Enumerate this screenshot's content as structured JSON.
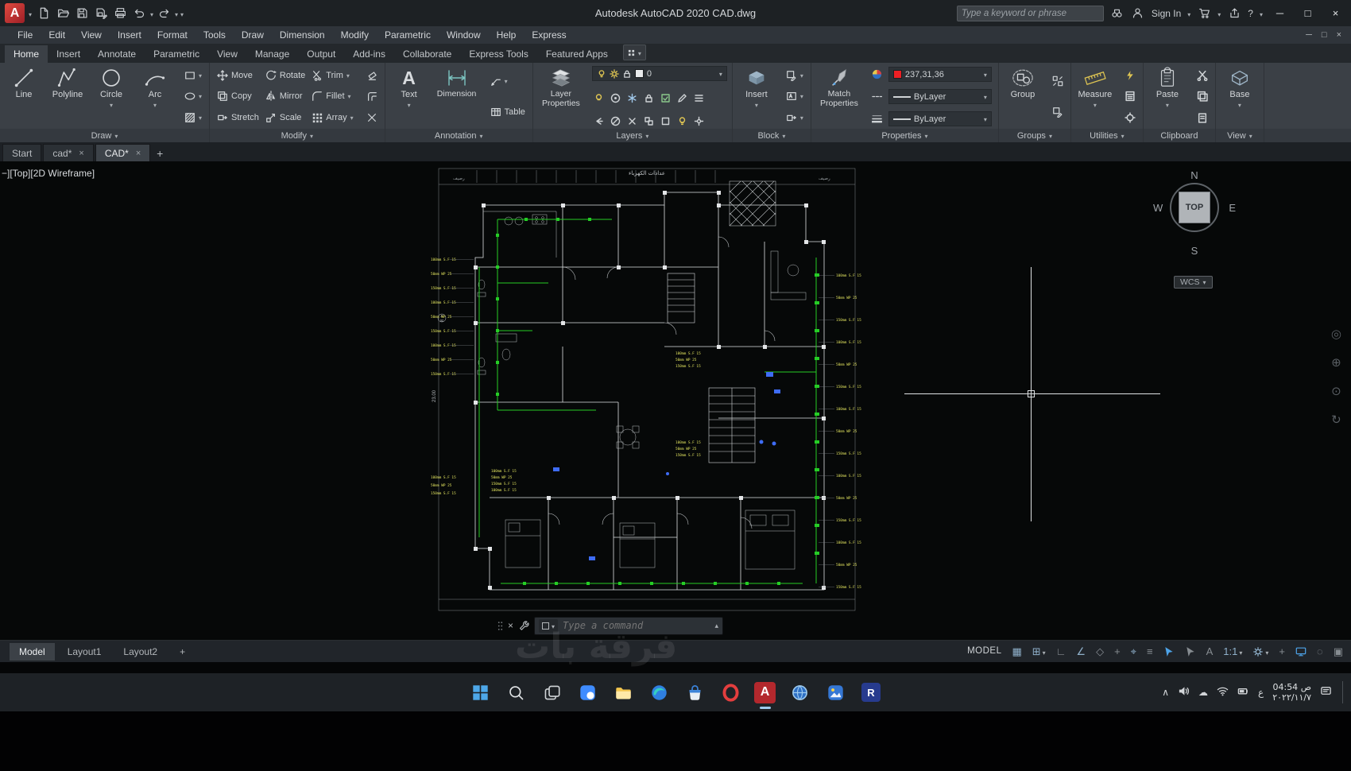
{
  "titlebar": {
    "title": "Autodesk AutoCAD 2020   CAD.dwg",
    "search_placeholder": "Type a keyword or phrase",
    "sign_in": "Sign In"
  },
  "menubar": {
    "items": [
      "File",
      "Edit",
      "View",
      "Insert",
      "Format",
      "Tools",
      "Draw",
      "Dimension",
      "Modify",
      "Parametric",
      "Window",
      "Help",
      "Express"
    ]
  },
  "ribbon": {
    "tabs": [
      "Home",
      "Insert",
      "Annotate",
      "Parametric",
      "View",
      "Manage",
      "Output",
      "Add-ins",
      "Collaborate",
      "Express Tools",
      "Featured Apps"
    ],
    "draw": {
      "label": "Draw",
      "line": "Line",
      "polyline": "Polyline",
      "circle": "Circle",
      "arc": "Arc"
    },
    "modify": {
      "label": "Modify",
      "move": "Move",
      "rotate": "Rotate",
      "trim": "Trim",
      "copy": "Copy",
      "mirror": "Mirror",
      "fillet": "Fillet",
      "stretch": "Stretch",
      "scale": "Scale",
      "array": "Array"
    },
    "annotation": {
      "label": "Annotation",
      "text": "Text",
      "dimension": "Dimension",
      "table": "Table"
    },
    "layers": {
      "label": "Layers",
      "layer_properties": "Layer Properties",
      "current_layer": "0"
    },
    "block": {
      "label": "Block",
      "insert": "Insert"
    },
    "properties": {
      "label": "Properties",
      "match_properties": "Match Properties",
      "color_value": "237,31,36",
      "linetype": "ByLayer",
      "lineweight": "ByLayer"
    },
    "groups": {
      "label": "Groups",
      "group": "Group"
    },
    "utilities": {
      "label": "Utilities",
      "measure": "Measure"
    },
    "clipboard": {
      "label": "Clipboard",
      "paste": "Paste"
    },
    "view": {
      "label": "View",
      "base": "Base"
    }
  },
  "file_tabs": [
    "Start",
    "cad*",
    "CAD*"
  ],
  "viewport": {
    "vp_label": "−][Top][2D Wireframe]",
    "viewcube": {
      "n": "N",
      "w": "W",
      "e": "E",
      "s": "S",
      "top": "TOP"
    },
    "wcs": "WCS",
    "watermark": "فرقة بات"
  },
  "floorplan": {
    "top_label": "عدادات الكهرباء",
    "sidewalk_left": "رصيف",
    "sidewalk_right": "رصيف",
    "side_dim": "23.00",
    "marker": "A",
    "marker_no": "02",
    "note_a": "100mm S.F 15",
    "note_b": "50mm WP 25",
    "note_c": "150mm S.F 15",
    "left_ys": [
      122,
      140,
      158,
      176,
      194,
      212,
      230,
      248,
      266
    ],
    "right_ys": [
      142,
      170,
      198,
      226,
      254,
      282,
      310,
      338,
      366,
      394,
      422,
      450,
      478,
      506,
      534
    ],
    "cluster1_ys": [
      388,
      396,
      404,
      412
    ],
    "cluster2_ys": [
      240,
      248,
      256
    ],
    "cluster3_ys": [
      352,
      360,
      368
    ],
    "cluster4_ys": [
      396,
      406,
      416
    ]
  },
  "command": {
    "placeholder": "Type a command"
  },
  "layouts": {
    "model": "Model",
    "layout1": "Layout1",
    "layout2": "Layout2"
  },
  "status": {
    "model": "MODEL",
    "scale": "1:1"
  },
  "taskbar": {
    "language": "ع",
    "time": "04:54 ص",
    "date": "٢٠٢٢/١١/٧"
  },
  "icons": {
    "close": "×",
    "minimize": "─",
    "maximize": "□",
    "help": "?",
    "up": "▴",
    "plus": "+",
    "grid": "▦",
    "snap": "⊞",
    "ortho": "∟",
    "polar": "∠",
    "iso": "◇",
    "otrack": "+",
    "osnap": "⌖",
    "lineweight": "≡",
    "annotation": "A",
    "isolate": "◌",
    "clean": "▣",
    "chevron_up": "∧",
    "cloud": "☁",
    "nav_wheel": "◎",
    "nav_pan": "⊕",
    "nav_zoom": "⊙",
    "nav_orbit": "↻",
    "text_tool": "A"
  }
}
